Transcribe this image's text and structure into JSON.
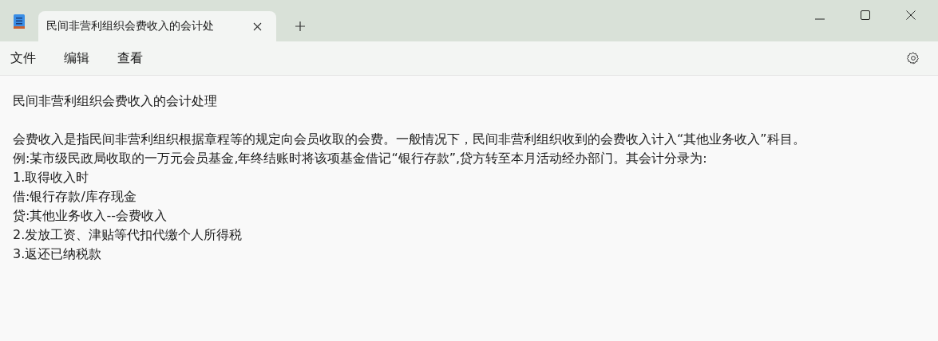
{
  "tabs": [
    {
      "label": "民间非营利组织会费收入的会计处",
      "selected": true
    }
  ],
  "menu": [
    "文件",
    "编辑",
    "查看"
  ],
  "document": {
    "paragraphs": [
      {
        "lines": [
          "民间非营利组织会费收入的会计处理"
        ]
      },
      {
        "lines": [
          "会费收入是指民间非营利组织根据章程等的规定向会员收取的会费。一般情况下，民间非营利组织收到的会费收入计入“其他业务收入”科目。",
          "例:某市级民政局收取的一万元会员基金,年终结账时将该项基金借记“银行存款”,贷方转至本月活动经办部门。其会计分录为:",
          "1.取得收入时",
          "借:银行存款/库存现金",
          "贷:其他业务收入--会费收入",
          "2.发放工资、津贴等代扣代缴个人所得税",
          "3.返还已纳税款"
        ]
      }
    ]
  }
}
